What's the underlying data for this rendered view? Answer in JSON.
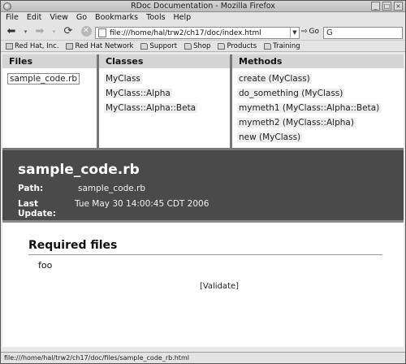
{
  "window": {
    "title": "RDoc Documentation - Mozilla Firefox"
  },
  "menu": [
    {
      "label": "File"
    },
    {
      "label": "Edit"
    },
    {
      "label": "View"
    },
    {
      "label": "Go"
    },
    {
      "label": "Bookmarks"
    },
    {
      "label": "Tools"
    },
    {
      "label": "Help"
    }
  ],
  "nav": {
    "url": "file:///home/hal/trw2/ch17/doc/index.html",
    "go_label": "Go",
    "search_value": ""
  },
  "bookmarks": [
    {
      "label": "Red Hat, Inc.",
      "icon": "page-icon"
    },
    {
      "label": "Red Hat Network",
      "icon": "page-icon"
    },
    {
      "label": "Support",
      "icon": "folder-icon"
    },
    {
      "label": "Shop",
      "icon": "folder-icon"
    },
    {
      "label": "Products",
      "icon": "folder-icon"
    },
    {
      "label": "Training",
      "icon": "folder-icon"
    }
  ],
  "frames": {
    "files": {
      "header": "Files",
      "items": [
        "sample_code.rb"
      ]
    },
    "classes": {
      "header": "Classes",
      "items": [
        "MyClass",
        "MyClass::Alpha",
        "MyClass::Alpha::Beta"
      ]
    },
    "methods": {
      "header": "Methods",
      "items": [
        "create (MyClass)",
        "do_something (MyClass)",
        "mymeth1 (MyClass::Alpha::Beta)",
        "mymeth2 (MyClass::Alpha)",
        "new (MyClass)"
      ]
    }
  },
  "banner": {
    "file_title": "sample_code.rb",
    "path_label": "Path:",
    "path_value": "sample_code.rb",
    "update_label": "Last Update:",
    "update_value": "Tue May 30 14:00:45 CDT 2006"
  },
  "body": {
    "section_title": "Required files",
    "required": [
      "foo"
    ],
    "validate": "[Validate]"
  },
  "status": {
    "text": "file:///home/hal/trw2/ch17/doc/files/sample_code_rb.html"
  },
  "colors": {
    "banner": "#4a4a4a",
    "frame_header": "#d4d4d4",
    "chrome": "#e4e4e4"
  }
}
